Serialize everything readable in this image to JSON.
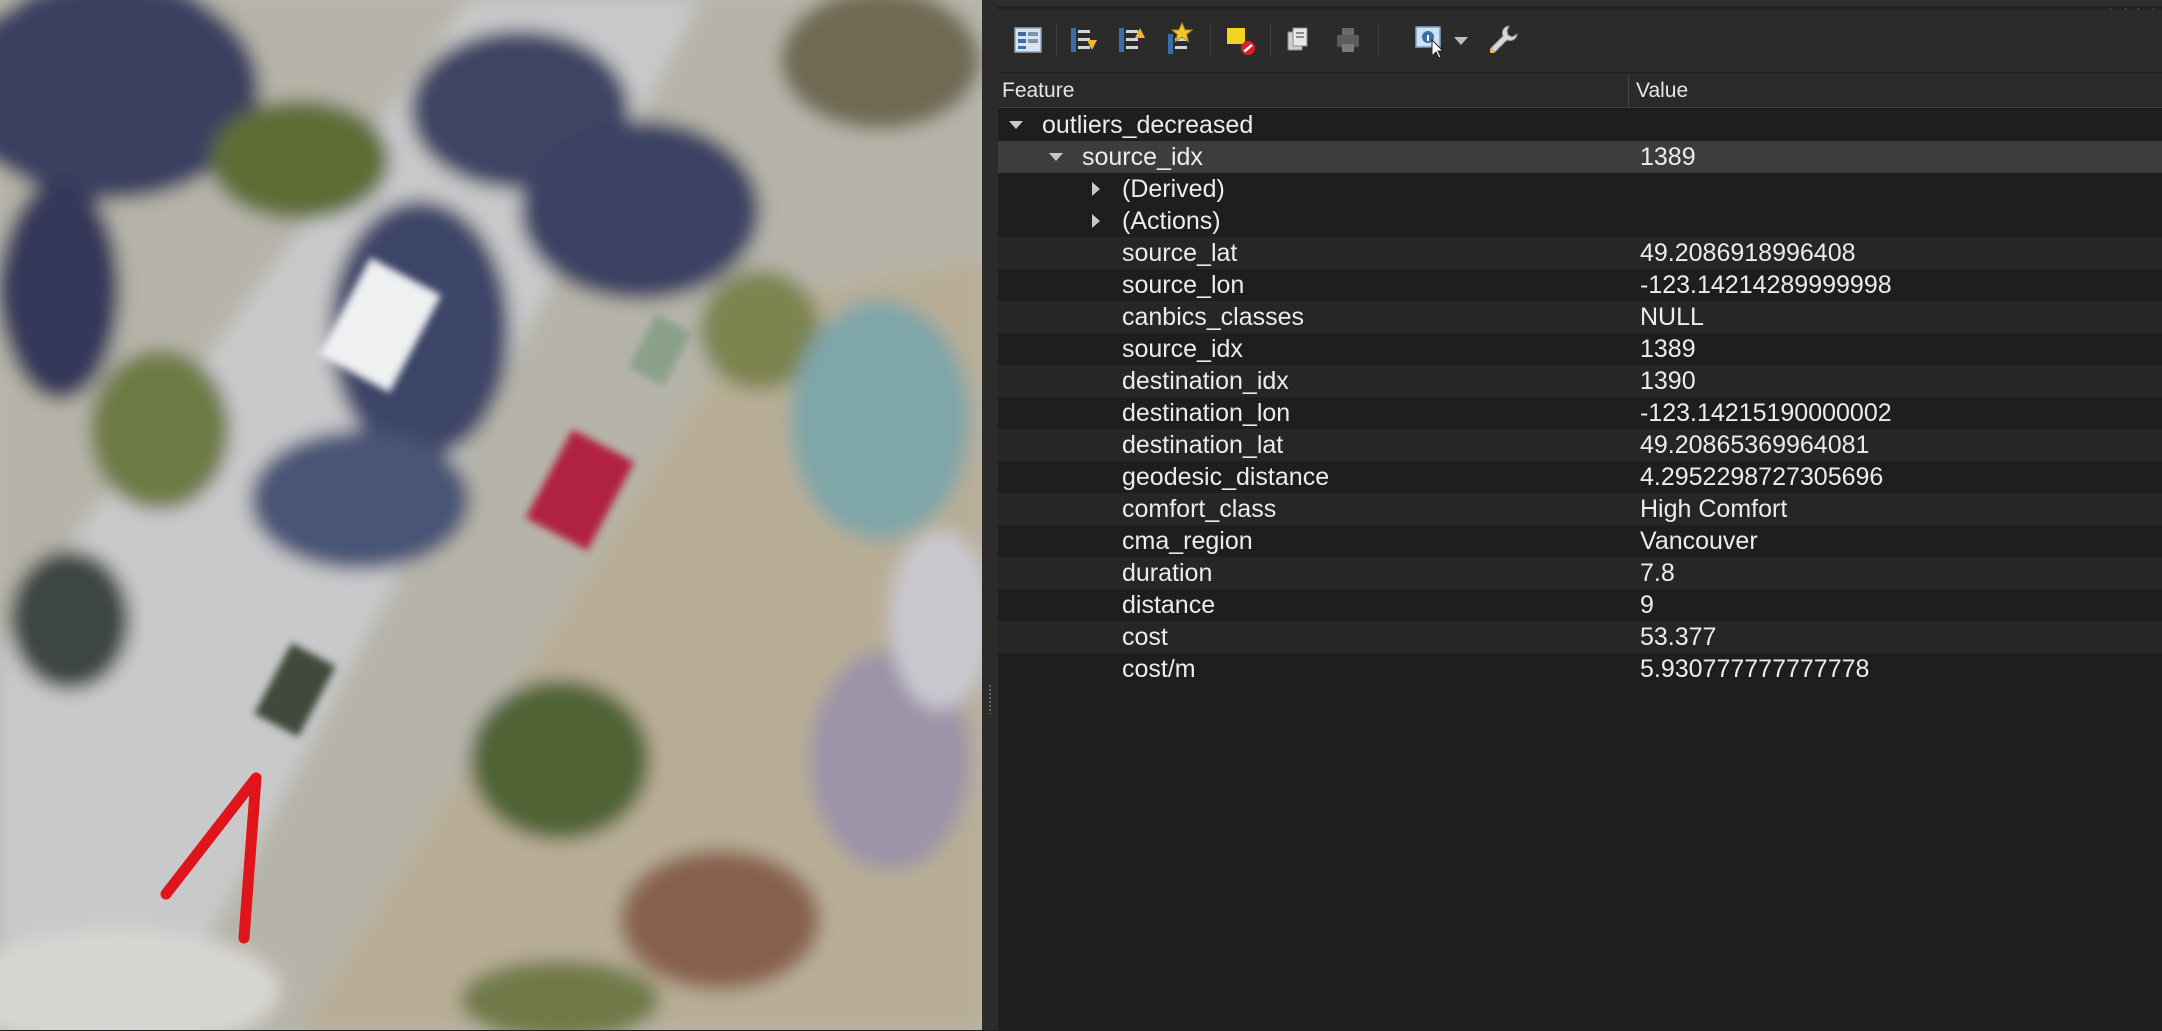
{
  "tree": {
    "headers": {
      "feature": "Feature",
      "value": "Value"
    },
    "layer": "outliers_decreased",
    "feature_node": {
      "label": "source_idx",
      "value": "1389"
    },
    "groups": [
      "(Derived)",
      "(Actions)"
    ],
    "attributes": [
      {
        "field": "source_lat",
        "value": "49.2086918996408"
      },
      {
        "field": "source_lon",
        "value": "-123.14214289999998"
      },
      {
        "field": "canbics_classes",
        "value": "NULL"
      },
      {
        "field": "source_idx",
        "value": "1389"
      },
      {
        "field": "destination_idx",
        "value": "1390"
      },
      {
        "field": "destination_lon",
        "value": "-123.14215190000002"
      },
      {
        "field": "destination_lat",
        "value": "49.20865369964081"
      },
      {
        "field": "geodesic_distance",
        "value": "4.2952298727305696"
      },
      {
        "field": "comfort_class",
        "value": "High Comfort"
      },
      {
        "field": "cma_region",
        "value": "Vancouver"
      },
      {
        "field": "duration",
        "value": "7.8"
      },
      {
        "field": "distance",
        "value": "9"
      },
      {
        "field": "cost",
        "value": "53.377"
      },
      {
        "field": "cost/m",
        "value": "5.930777777777778"
      }
    ]
  },
  "toolbar": {
    "icons": [
      "expand-tree-icon",
      "expand-all-icon",
      "collapse-all-icon",
      "expand-new-results-icon",
      "clear-results-icon",
      "copy-feature-icon",
      "print-icon",
      "identify-mode-icon",
      "dropdown-arrow-icon",
      "settings-wrench-icon"
    ]
  },
  "colors": {
    "panel_bg": "#1e1e1e",
    "toolbar_bg": "#2b2b2b",
    "selected_row": "#3d3d3d",
    "map_route_line": "#e0151b"
  }
}
